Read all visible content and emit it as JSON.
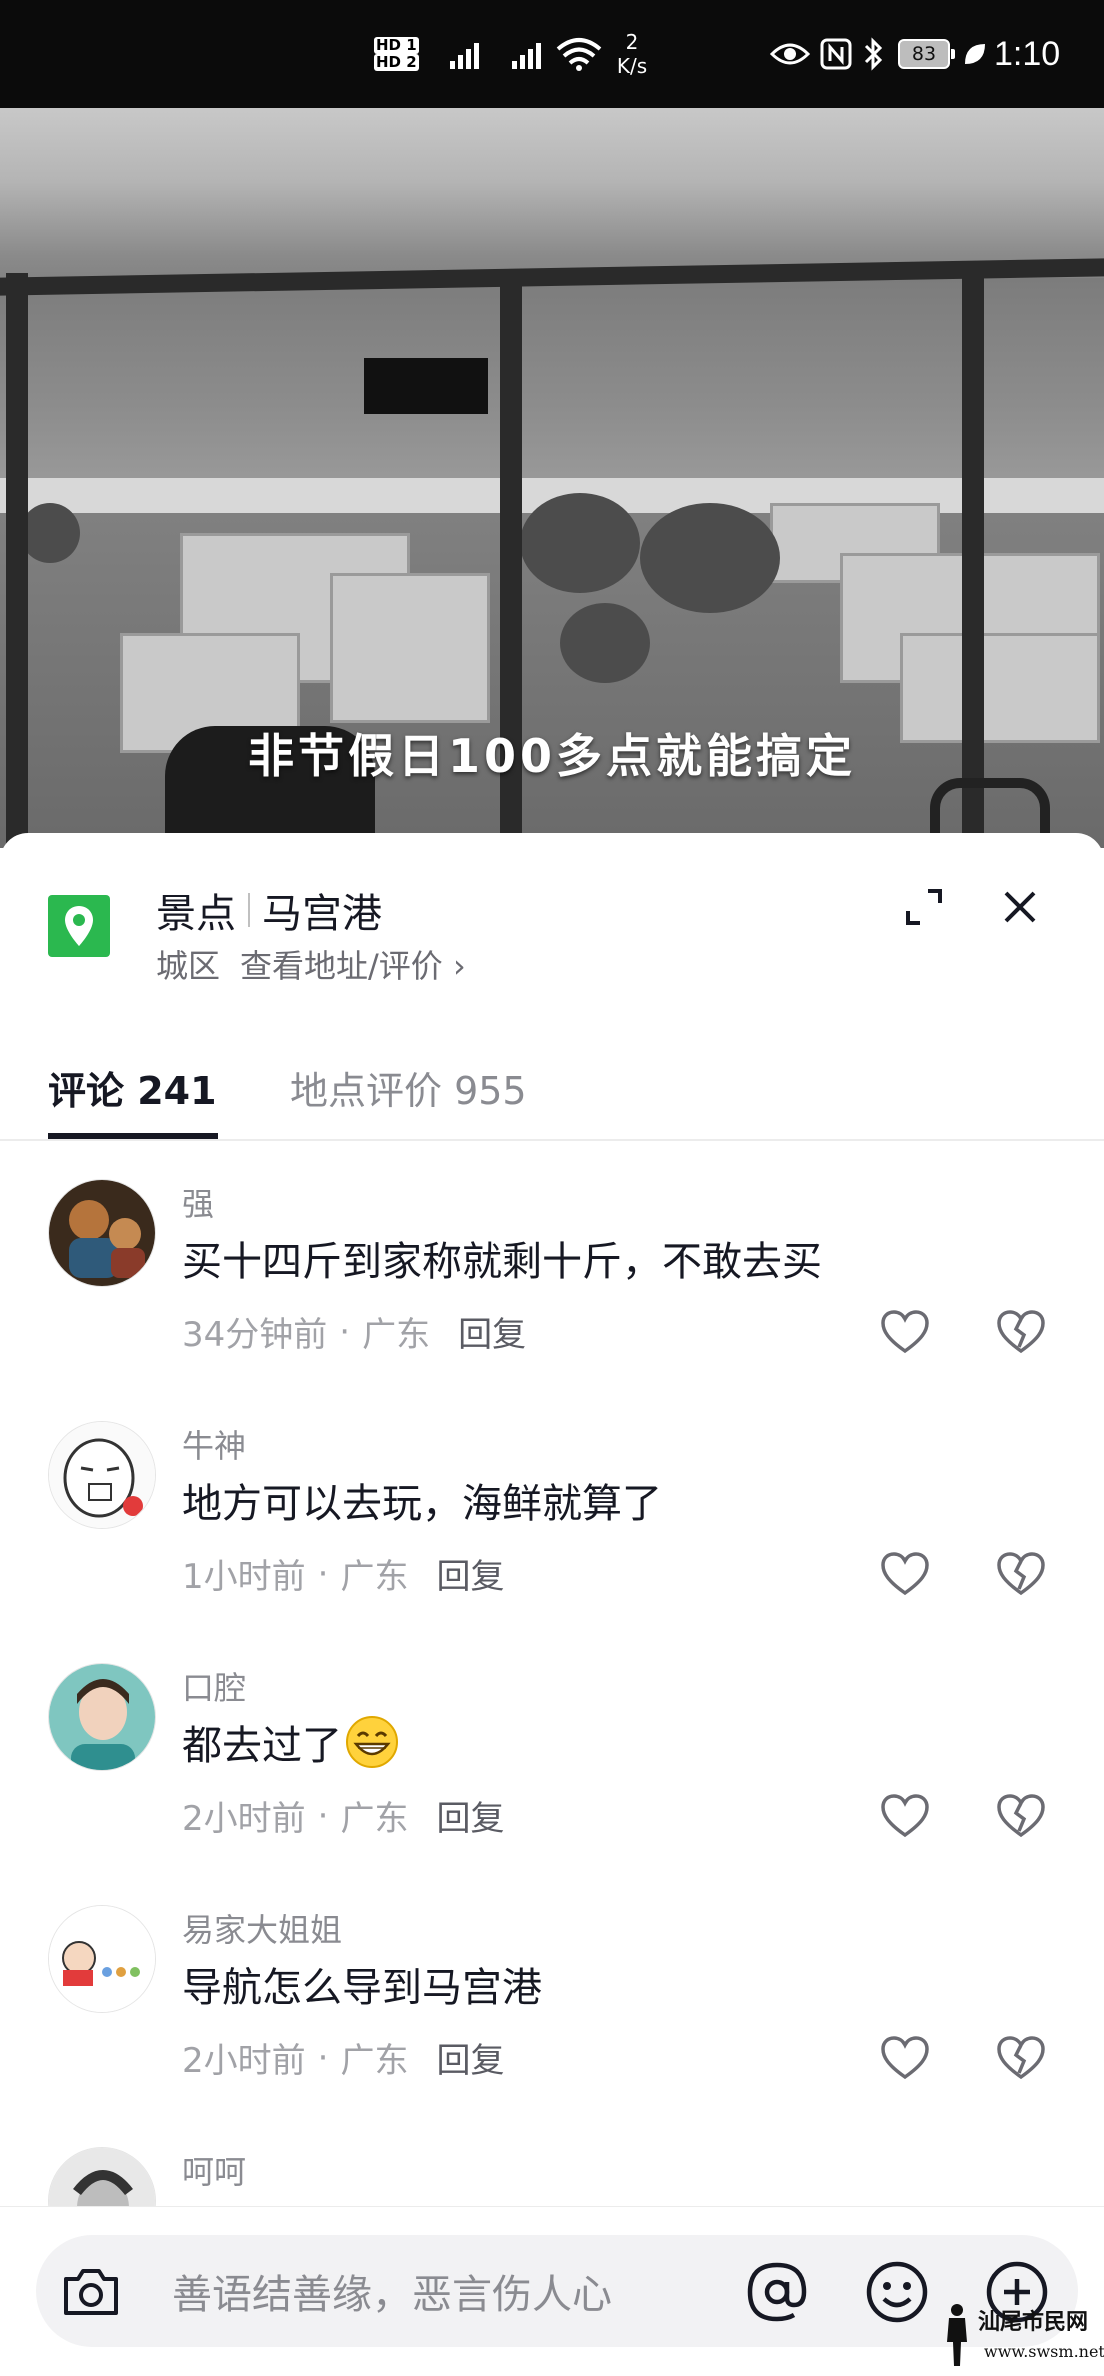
{
  "status_bar": {
    "hd1": "HD 1",
    "hd2": "HD 2",
    "net_speed_value": "2",
    "net_speed_unit": "K/s",
    "battery": "83",
    "time": "1:10"
  },
  "video": {
    "caption": "非节假日100多点就能搞定"
  },
  "location": {
    "category": "景点",
    "name": "马宫港",
    "area": "城区",
    "link": "查看地址/评价 ›",
    "icon": "map-pin-icon",
    "icon_color": "#2bb84f"
  },
  "tabs": [
    {
      "label": "评论 241",
      "active": true
    },
    {
      "label": "地点评价 955",
      "active": false
    }
  ],
  "comments": [
    {
      "user": "强",
      "text": "买十四斤到家称就剩十斤，不敢去买",
      "time": "34分钟前",
      "region": "广东",
      "reply": "回复"
    },
    {
      "user": "牛神",
      "text": "地方可以去玩，海鲜就算了",
      "time": "1小时前",
      "region": "广东",
      "reply": "回复"
    },
    {
      "user": "口腔",
      "text": "都去过了",
      "time": "2小时前",
      "region": "广东",
      "reply": "回复"
    },
    {
      "user": "易家大姐姐",
      "text": "导航怎么导到马宫港",
      "time": "2小时前",
      "region": "广东",
      "reply": "回复"
    },
    {
      "user": "呵呵",
      "text": "",
      "time": "",
      "region": "",
      "reply": ""
    }
  ],
  "input": {
    "placeholder": "善语结善缘，恶言伤人心"
  },
  "watermark": {
    "text": "汕尾市民网",
    "url": "www.swsm.net"
  }
}
